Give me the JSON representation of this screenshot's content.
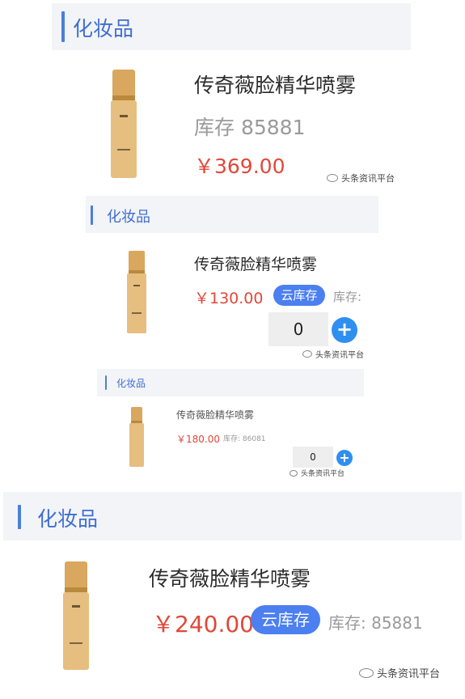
{
  "cards": [
    {
      "category": "化妆品",
      "product_name": "传奇薇脸精华喷雾",
      "stock_label": "库存 85881",
      "price": "￥369.00",
      "watermark": "头条资讯平台"
    },
    {
      "category": "化妆品",
      "product_name": "传奇薇脸精华喷雾",
      "price": "￥130.00",
      "badge": "云库存",
      "stock_label": "库存:",
      "quantity": "0",
      "plus": "+",
      "watermark": "头条资讯平台"
    },
    {
      "category": "化妆品",
      "product_name": "传奇薇脸精华喷雾",
      "price": "￥180.00",
      "stock_label": "库存: 86081",
      "quantity": "0",
      "plus": "+",
      "watermark": "头条资讯平台"
    },
    {
      "category": "化妆品",
      "product_name": "传奇薇脸精华喷雾",
      "price": "￥240.00",
      "badge": "云库存",
      "stock_label": "库存: 85881",
      "watermark": "头条资讯平台"
    }
  ],
  "colors": {
    "accent": "#4a7fd8",
    "price": "#e0483a",
    "badge": "#4c7ff0",
    "plus": "#2f8ff0",
    "header_bg": "#f3f4f7"
  },
  "icons": [
    "product-bottle-image",
    "watermark-logo-icon",
    "plus-icon"
  ]
}
